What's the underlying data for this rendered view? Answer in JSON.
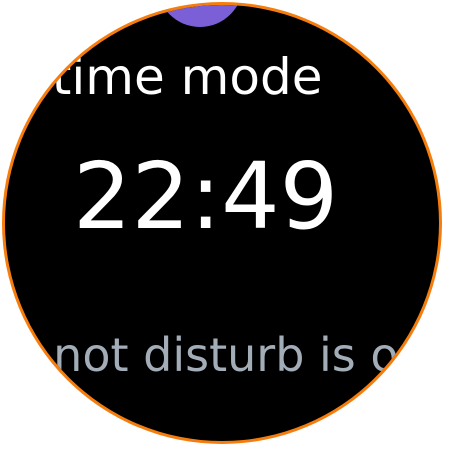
{
  "screen": {
    "title": "Bedtime mode",
    "time": "22:49",
    "status_text": "Do not disturb is on"
  },
  "colors": {
    "background": "#000000",
    "bezel": "#f47d0e",
    "accent_icon": "#7b5fd6",
    "primary_text": "#ffffff",
    "secondary_text": "#a3adb8"
  },
  "icons": {
    "top_icon": "moon-icon"
  }
}
